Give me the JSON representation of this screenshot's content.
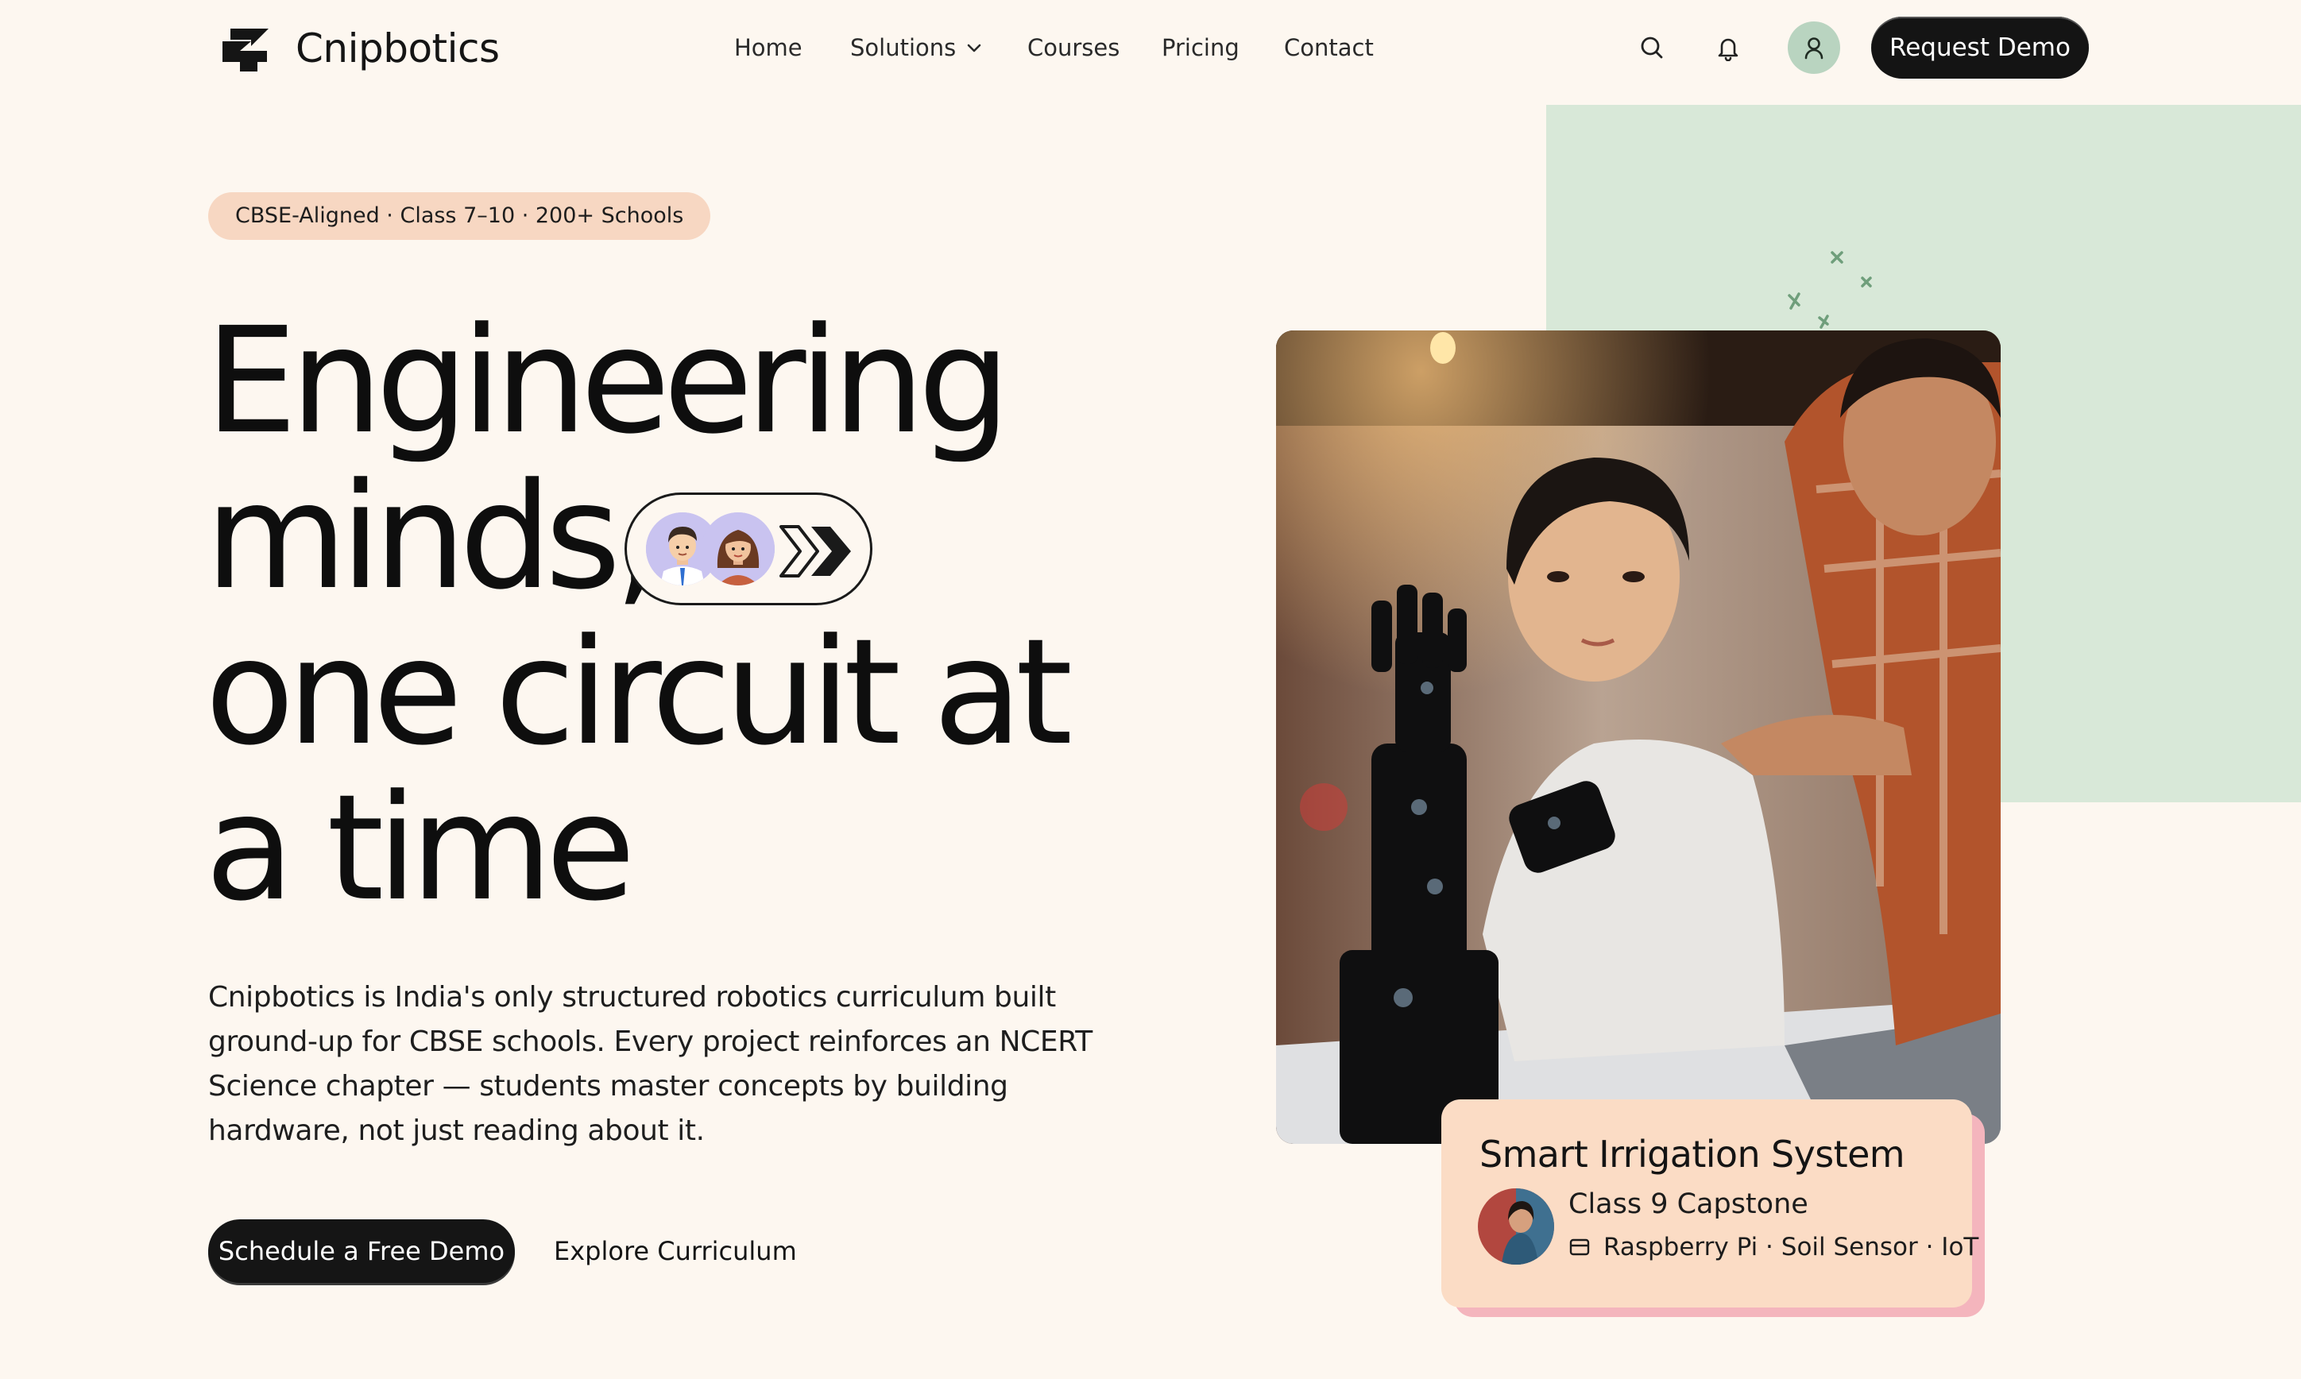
{
  "brand": {
    "name": "Cnipbotics"
  },
  "nav": {
    "items": [
      {
        "label": "Home"
      },
      {
        "label": "Solutions",
        "has_dropdown": true
      },
      {
        "label": "Courses"
      },
      {
        "label": "Pricing"
      },
      {
        "label": "Contact"
      }
    ],
    "icons": [
      "search-icon",
      "bell-icon",
      "user-icon"
    ],
    "cta_label": "Request Demo"
  },
  "hero": {
    "badge": "CBSE-Aligned · Class 7–10 · 200+ Schools",
    "headline_lines": [
      "Engineering",
      "minds,",
      "one circuit at",
      "a time"
    ],
    "description": "Cnipbotics is India's only structured robotics curriculum built ground-up for CBSE schools. Every project reinforces an NCERT Science chapter — students master concepts by building hardware, not just reading about it.",
    "primary_cta": "Schedule a Free Demo",
    "secondary_cta": "Explore Curriculum"
  },
  "project_card": {
    "title": "Smart Irrigation System",
    "subtitle": "Class 9 Capstone",
    "meta": "Raspberry Pi · Soil Sensor · IoT"
  },
  "colors": {
    "background": "#fdf7f0",
    "badge": "#f7d7c2",
    "accent_green": "#d8e8d8",
    "card": "#fbdcc5",
    "card_shadow": "#f4b5bd",
    "dark": "#141414"
  }
}
